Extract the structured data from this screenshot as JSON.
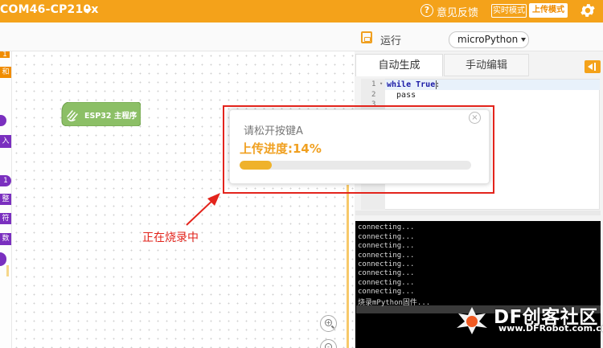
{
  "topbar": {
    "port": "COM46-CP210x",
    "feedback": "意见反馈",
    "mode_live": "实时模式",
    "mode_upload": "上传模式"
  },
  "toolbar": {
    "run": "运行",
    "board_select": "microPython"
  },
  "toolbox": {
    "items": [
      "1",
      "和",
      "",
      "入字",
      "1",
      "整数",
      "符",
      "数组",
      ""
    ]
  },
  "workspace": {
    "block_label": "ESP32 主程序"
  },
  "right_panel": {
    "tabs": [
      {
        "label": "自动生成",
        "active": true
      },
      {
        "label": "手动编辑",
        "active": false
      }
    ],
    "code": {
      "line_numbers": [
        "1",
        "2",
        "3"
      ],
      "line1_kw_while": "while",
      "line1_kw_true": "True",
      "line1_rest": ":",
      "line2": "  pass"
    },
    "console_lines": [
      "connecting...",
      "connecting...",
      "connecting...",
      "connecting...",
      "connecting...",
      "connecting...",
      "connecting...",
      "connecting...",
      "烧录mPython固件..."
    ]
  },
  "modal": {
    "hint": "请松开按键A",
    "progress_label": "上传进度:14%",
    "progress_fraction": 0.14,
    "close": "×"
  },
  "annotation": {
    "text": "正在烧录中"
  },
  "watermark": {
    "brand": "DF创客社区",
    "url": "www.DFRobot.com.cn"
  },
  "colors": {
    "accent": "#f4a21a",
    "annotation_red": "#e3241c",
    "progress": "#efb22b",
    "block_green": "#8cbf66"
  }
}
